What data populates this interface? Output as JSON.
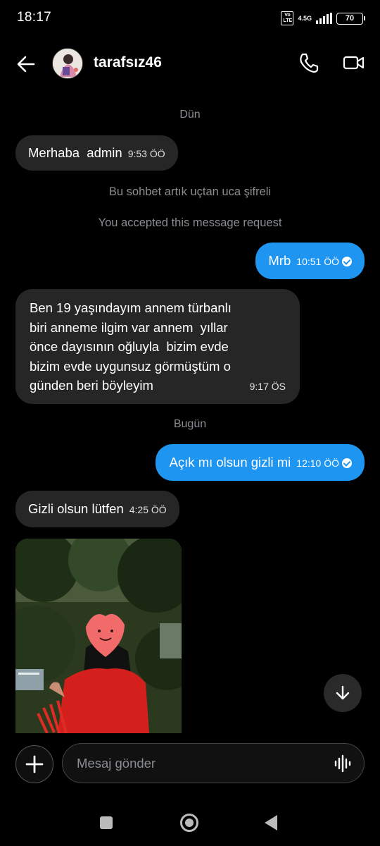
{
  "status_bar": {
    "time": "18:17",
    "volte": "Vo LTE",
    "network": "4.5G",
    "battery": "70"
  },
  "header": {
    "username": "tarafsız46",
    "back_icon": "arrow-left-icon",
    "call_icon": "phone-icon",
    "video_icon": "video-camera-icon"
  },
  "chat": {
    "date_yesterday": "Dün",
    "date_today": "Bugün",
    "system_encrypted": "Bu sohbet artık uçtan uca şifreli",
    "system_accepted": "You accepted this message request",
    "messages": [
      {
        "direction": "in",
        "text": "Merhaba  admin",
        "time": "9:53 ÖÖ"
      },
      {
        "direction": "out",
        "text": "Mrb",
        "time": "10:51 ÖÖ",
        "read": true
      },
      {
        "direction": "in",
        "lines": [
          "Ben 19 yaşındayım annem türbanlı",
          "biri anneme ilgim var annem  yıllar",
          "önce dayısının oğluyla  bizim evde",
          "bizim evde uygunsuz görmüştüm o",
          "günden beri böyleyim"
        ],
        "time": "9:17 ÖS"
      },
      {
        "direction": "out",
        "text": "Açık mı olsun gizli mi",
        "time": "12:10 ÖÖ",
        "read": true
      },
      {
        "direction": "in",
        "text": "Gizli olsun lütfen",
        "time": "4:25 ÖÖ"
      }
    ]
  },
  "composer": {
    "placeholder": "Mesaj gönder",
    "plus_icon": "plus-icon",
    "voice_icon": "voice-waveform-icon"
  },
  "colors": {
    "outgoing_bubble": "#1e95f0",
    "incoming_bubble": "#262626",
    "background": "#000000"
  }
}
